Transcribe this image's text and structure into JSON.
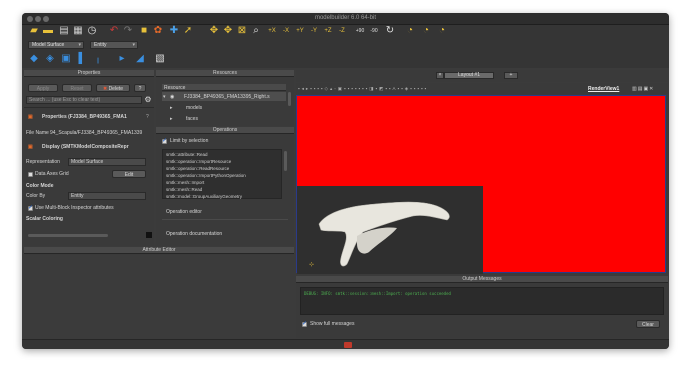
{
  "window": {
    "title": "modelbuilder 6.0 64-bit"
  },
  "toolbar": {
    "row1_icons": [
      "open-icon",
      "folder-icon",
      "save-icon",
      "save-state-icon",
      "clock-icon",
      "undo-icon",
      "redo-icon",
      "cube-icon",
      "palette-icon",
      "pick-icon",
      "select-icon",
      "reset-camera-icon",
      "zoom-data-icon",
      "zoom-box-icon",
      "plus-x-icon",
      "minus-x-icon",
      "plus-y-icon",
      "minus-y-icon",
      "plus-z-icon",
      "minus-z-icon",
      "rotate-cw-icon",
      "rotate-ccw-icon",
      "refresh-icon",
      "play-first-icon",
      "play-icon",
      "play-last-icon"
    ],
    "axis_labels": [
      "+X",
      "-X",
      "+Y",
      "-Y",
      "+Z",
      "-Z",
      "+90",
      "-90"
    ],
    "model_combo": "Model Surface",
    "entity_combo": "Entity"
  },
  "properties": {
    "header": "Properties",
    "apply": "Apply",
    "reset": "Reset",
    "delete": "Delete",
    "help": "?",
    "search_placeholder": "Search ... (use Esc to clear text)",
    "section_properties": "Properties (FJ3384_BP49365_FMA1",
    "file_name_label": "File Name",
    "file_name_value": "94_Scapula/FJ3384_BP49365_FMA1339",
    "section_display": "Display (SMTKModelCompositeRepr",
    "representation_label": "Representation",
    "representation_value": "Model Surface",
    "data_axes_grid": "Data Axes Grid",
    "edit": "Edit",
    "color_mode": "Color Mode",
    "color_by_label": "Color By",
    "color_by_value": "Entity",
    "multiblock": "Use Multi-Block Inspector attributes",
    "scalar_coloring": "Scalar Coloring"
  },
  "resources": {
    "header": "Resources",
    "column": "Resource",
    "root": "FJ3384_BP49365_FMA13395_Right.s",
    "children": [
      "models",
      "faces"
    ]
  },
  "operations": {
    "header": "Operations",
    "limit_by_selection": "Limit by selection",
    "items": [
      "smtk::attribute::Read",
      "smtk::operation::ImportResource",
      "smtk::operation::ReadResource",
      "smtk::operation::ImportPythonOperation",
      "smtk::mesh::Import",
      "smtk::mesh::Read",
      "smtk::model::GroupAuxiliaryGeometry"
    ],
    "editor": "Operation editor",
    "documentation": "Operation documentation"
  },
  "attribute_editor": {
    "header": "Attribute Editor"
  },
  "layout": {
    "tab": "Layout #1",
    "add": "+",
    "view_name": "RenderView1"
  },
  "output": {
    "header": "Output Messages",
    "message": "DEBUG: INFO: smtk::session::mesh::Import: operation succeeded",
    "show_full": "Show full messages",
    "clear": "Clear"
  },
  "colors": {
    "render_bg": "#ff0000",
    "viewport": "#2e2e2e",
    "accent": "#1a5fd0"
  }
}
